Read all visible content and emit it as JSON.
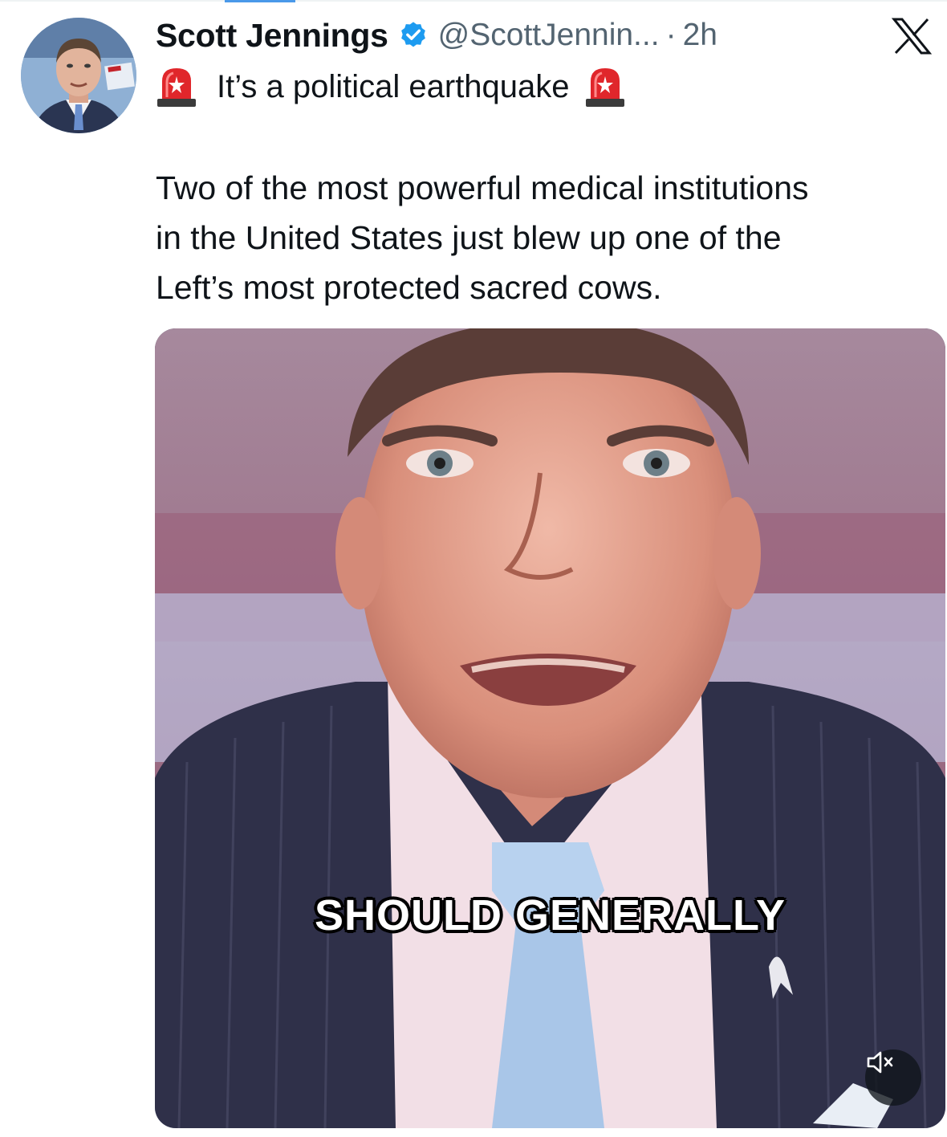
{
  "tweet": {
    "author": {
      "display_name": "Scott Jennings",
      "handle": "@ScottJennin...",
      "verified": true
    },
    "separator": "·",
    "time": "2h",
    "headline": "It’s a political earthquake",
    "body": "Two of the most powerful medical institutions\nin the United States just blew up one of the\nLeft’s most protected sacred cows.",
    "media": {
      "type": "video",
      "caption": "SHOULD GENERALLY",
      "muted": true
    }
  },
  "colors": {
    "verified_badge": "#1d9bf0",
    "secondary_text": "#536471",
    "siren_red": "#e0262b"
  },
  "icons": [
    "verified-badge-icon",
    "x-logo-icon",
    "siren-icon",
    "volume-muted-icon"
  ]
}
